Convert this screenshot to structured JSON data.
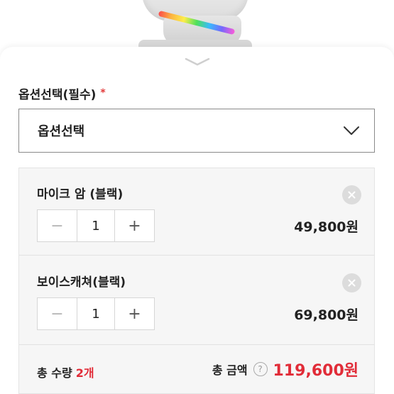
{
  "option_section": {
    "label": "옵션선택(필수)",
    "required_mark": "*",
    "select_value": "옵션선택"
  },
  "cart_items": [
    {
      "name": "마이크 암 (블랙)",
      "quantity": "1",
      "price": "49,800원"
    },
    {
      "name": "보이스캐쳐(블랙)",
      "quantity": "1",
      "price": "69,800원"
    }
  ],
  "stepper": {
    "minus": "−",
    "plus": "+"
  },
  "summary": {
    "quantity_label": "총 수량",
    "quantity_count": "2개",
    "amount_label": "총 금액",
    "help": "?",
    "amount_value": "119,600원"
  },
  "colors": {
    "accent_red": "#e12c38",
    "required_red": "#e23b3b"
  },
  "icons": [
    "chevron-down-icon",
    "close-icon",
    "help-icon",
    "minus-icon",
    "plus-icon"
  ]
}
